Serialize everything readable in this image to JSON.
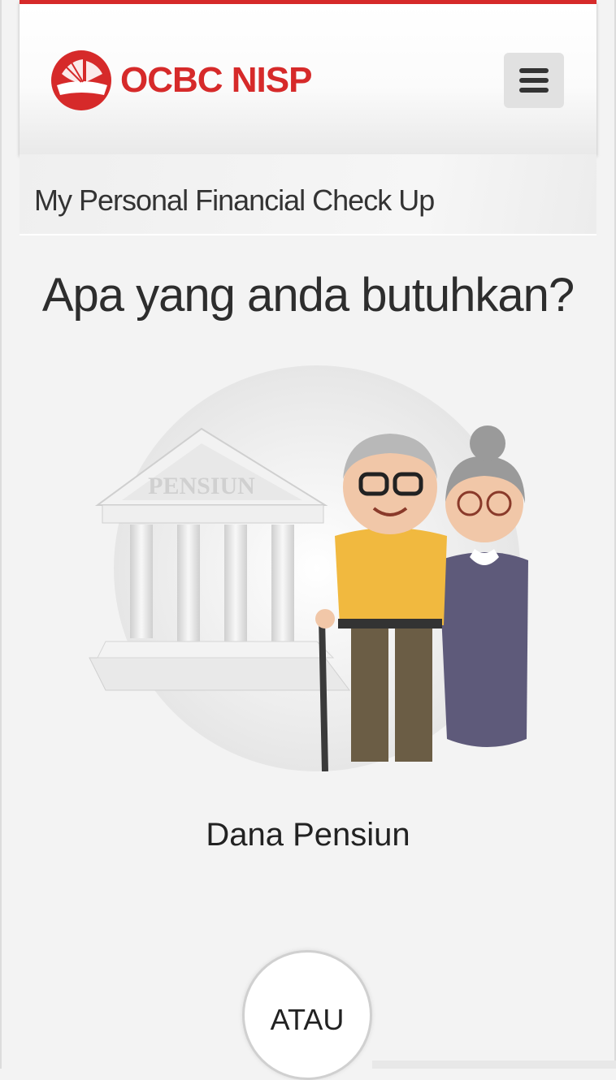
{
  "header": {
    "brand": "OCBC NISP",
    "menu_icon": "hamburger-icon",
    "brand_color": "#d62a2a"
  },
  "title_bar": {
    "title": "My Personal Financial Check Up"
  },
  "main": {
    "question": "Apa yang anda butuhkan?",
    "option": {
      "label": "Dana Pensiun",
      "illustration_text": "PENSIUN"
    },
    "separator": "ATAU"
  }
}
